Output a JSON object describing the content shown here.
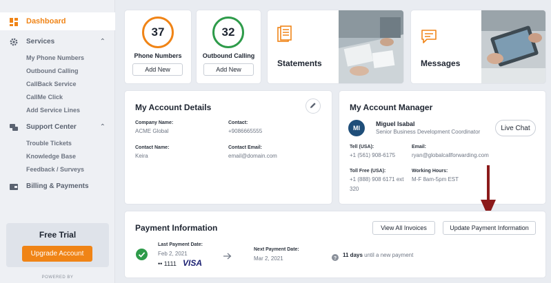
{
  "sidebar": {
    "dashboard_label": "Dashboard",
    "services_label": "Services",
    "services_items": [
      "My Phone Numbers",
      "Outbound Calling",
      "CallBack Service",
      "CallMe Click",
      "Add Service Lines"
    ],
    "support_label": "Support Center",
    "support_items": [
      "Trouble Tickets",
      "Knowledge Base",
      "Feedback / Surveys"
    ],
    "billing_label": "Billing & Payments",
    "trial_title": "Free Trial",
    "upgrade_label": "Upgrade Account",
    "powered_by": "POWERED BY",
    "accent_color": "#f08416"
  },
  "stats": {
    "phone_numbers": {
      "count": "37",
      "label": "Phone Numbers",
      "button": "Add New",
      "color": "#f08416"
    },
    "outbound": {
      "count": "32",
      "label": "Outbound Calling",
      "button": "Add New",
      "color": "#2e9b4a"
    }
  },
  "tiles": {
    "statements": "Statements",
    "messages": "Messages"
  },
  "account_details": {
    "title": "My Account Details",
    "company_name_label": "Company Name:",
    "company_name": "ACME Global",
    "contact_label": "Contact:",
    "contact": "+9086665555",
    "contact_name_label": "Contact Name:",
    "contact_name": "Keira",
    "contact_email_label": "Contact Email:",
    "contact_email": "email@domain.com"
  },
  "account_manager": {
    "title": "My Account Manager",
    "initials": "MI",
    "name": "Miguel Isabal",
    "role": "Senior Business Development Coordinator",
    "live_chat": "Live Chat",
    "tell_label": "Tell (USA):",
    "tell": "+1 (561) 908-6175",
    "email_label": "Email:",
    "email": "ryan@globalcallforwarding.com",
    "toll_free_label": "Toll Free (USA):",
    "toll_free_line1": "+1 (888) 908 6171 ext",
    "toll_free_line2": "320",
    "hours_label": "Working Hours:",
    "hours": "M-F 8am-5pm EST"
  },
  "payment": {
    "title": "Payment Information",
    "view_invoices": "View All Invoices",
    "update_payment": "Update Payment Information",
    "last_label": "Last Payment Date:",
    "last_date": "Feb 2, 2021",
    "card_digits": "•• 1111",
    "card_brand": "VISA",
    "next_label": "Next Payment Date:",
    "next_date": "Mar 2, 2021",
    "days_bold": "11 days",
    "days_rest": "until a new payment"
  }
}
